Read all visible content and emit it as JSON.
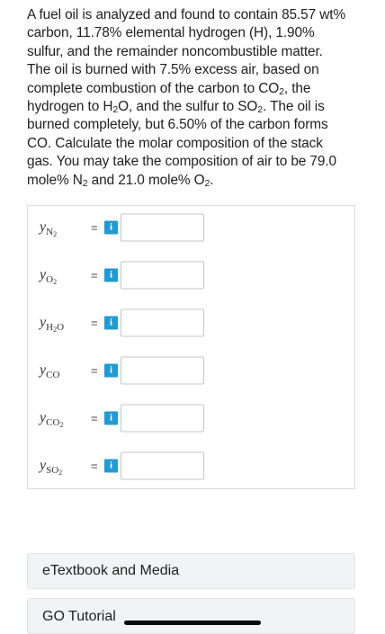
{
  "problem": {
    "line1": "A fuel oil is analyzed and found to contain 85.57 wt%",
    "line2": "carbon, 11.78% elemental hydrogen (H), 1.90%",
    "line3": "sulfur, and the remainder noncombustible matter.",
    "line4": "The oil is burned with 7.5% excess air, based on",
    "line5a": "complete combustion of the carbon to CO",
    "line5b": ", the",
    "line6a": "hydrogen to H",
    "line6b": "O, and the sulfur to SO",
    "line6c": ". The oil is",
    "line7": "burned completely, but 6.50% of the carbon forms",
    "line8": "CO. Calculate the molar composition of the stack",
    "line9": "gas. You may take the composition of air to be 79.0",
    "line10a": "mole% N",
    "line10b": " and 21.0 mole% O",
    "line10c": ".",
    "sub2": "2"
  },
  "answers": [
    {
      "var": "y",
      "sub": "N",
      "subsub": "2",
      "suffix": "",
      "equals": "=",
      "info": "i",
      "value": ""
    },
    {
      "var": "y",
      "sub": "O",
      "subsub": "2",
      "suffix": "",
      "equals": "=",
      "info": "i",
      "value": ""
    },
    {
      "var": "y",
      "sub": "H",
      "subsub": "2",
      "suffix": "O",
      "equals": "=",
      "info": "i",
      "value": ""
    },
    {
      "var": "y",
      "sub": "CO",
      "subsub": "",
      "suffix": "",
      "equals": "=",
      "info": "i",
      "value": ""
    },
    {
      "var": "y",
      "sub": "CO",
      "subsub": "2",
      "suffix": "",
      "equals": "=",
      "info": "i",
      "value": ""
    },
    {
      "var": "y",
      "sub": "SO",
      "subsub": "2",
      "suffix": "",
      "equals": "=",
      "info": "i",
      "value": ""
    }
  ],
  "resources": {
    "etextbook_label": "eTextbook and Media",
    "tutorial_label": "GO Tutorial"
  },
  "colors": {
    "info_button": "#1f9bd3",
    "redaction": "#0a0a0a"
  }
}
